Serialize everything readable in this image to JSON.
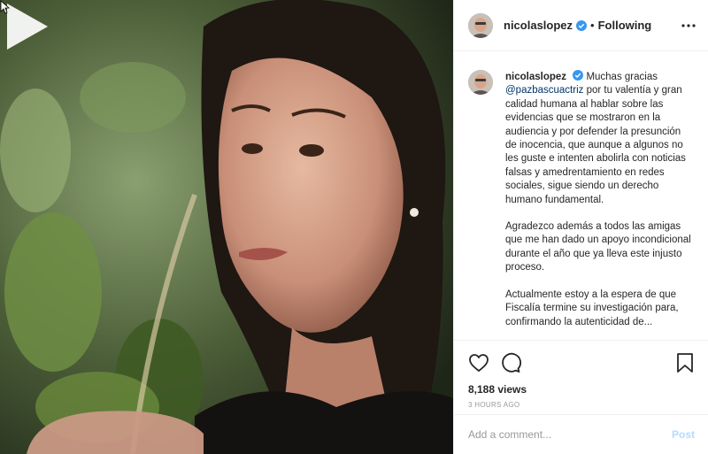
{
  "post": {
    "username": "nicolaslopez",
    "follow_status": "Following",
    "separator": "•",
    "caption": {
      "username": "nicolaslopez",
      "part1": "Muchas gracias",
      "mention": "@pazbascuactriz",
      "part2": "por tu valentía y gran calidad humana al hablar sobre las evidencias que se mostraron en la audiencia y por defender la presunción de inocencia, que aunque a algunos no les guste e intenten abolirla con noticias falsas y amedrentamiento en redes sociales, sigue siendo un derecho humano fundamental.",
      "paragraph2": "Agradezco además a todos las amigas que me han dado un apoyo incondicional durante el año que ya lleva este injusto proceso.",
      "paragraph3": "Actualmente estoy a la espera de que Fiscalía termine su investigación para, confirmando la autenticidad de..."
    },
    "views": "8,188 views",
    "time_ago": "3 HOURS AGO",
    "comment_placeholder": "Add a comment...",
    "post_label": "Post"
  },
  "icons": {
    "more": "more-options-icon",
    "like": "heart-icon",
    "comment": "comment-icon",
    "save": "bookmark-icon",
    "play": "play-icon",
    "verified": "verified-badge-icon"
  },
  "colors": {
    "verified_blue": "#3897f0",
    "post_disabled": "#b3dbff",
    "mention": "#003569",
    "muted": "#999999"
  }
}
